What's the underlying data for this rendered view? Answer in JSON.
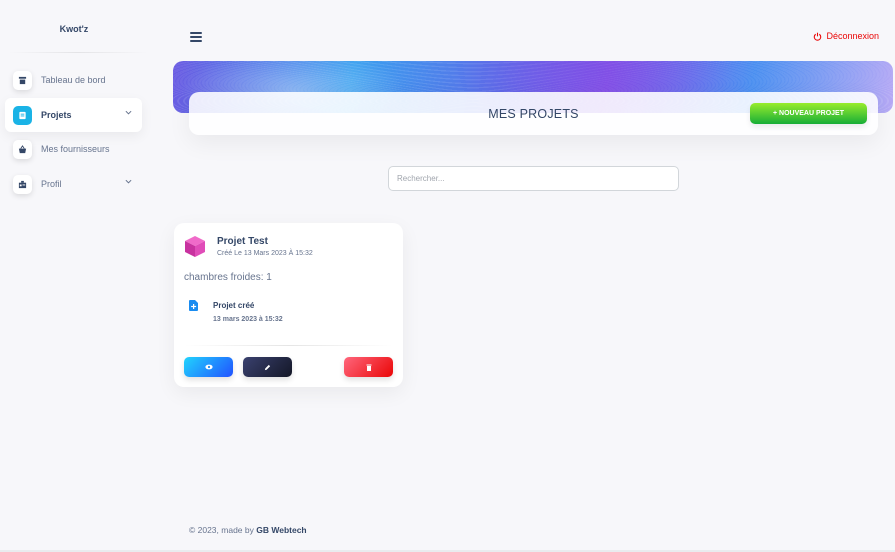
{
  "sidebar": {
    "brand": "Kwot'z",
    "items": [
      {
        "label": "Tableau de bord",
        "icon": "store-icon"
      },
      {
        "label": "Projets",
        "icon": "document-icon",
        "active": true
      },
      {
        "label": "Mes fournisseurs",
        "icon": "basket-icon"
      },
      {
        "label": "Profil",
        "icon": "profile-icon"
      }
    ]
  },
  "topbar": {
    "logout_label": "Déconnexion"
  },
  "header": {
    "title": "MES PROJETS",
    "new_project_label": "+ NOUVEAU PROJET"
  },
  "search": {
    "placeholder": "Rechercher..."
  },
  "project": {
    "name": "Projet Test",
    "created": "Créé Le 13 Mars 2023 À 15:32",
    "cold_rooms": "chambres froides: 1",
    "event_title": "Projet créé",
    "event_date": "13 mars 2023 à 15:32"
  },
  "footer": {
    "prefix": "© 2023, made by",
    "company": "GB Webtech"
  },
  "colors": {
    "accent_green": "#17ad37",
    "danger": "#ea0606",
    "info": "#21d4fd",
    "dark": "#344767"
  }
}
